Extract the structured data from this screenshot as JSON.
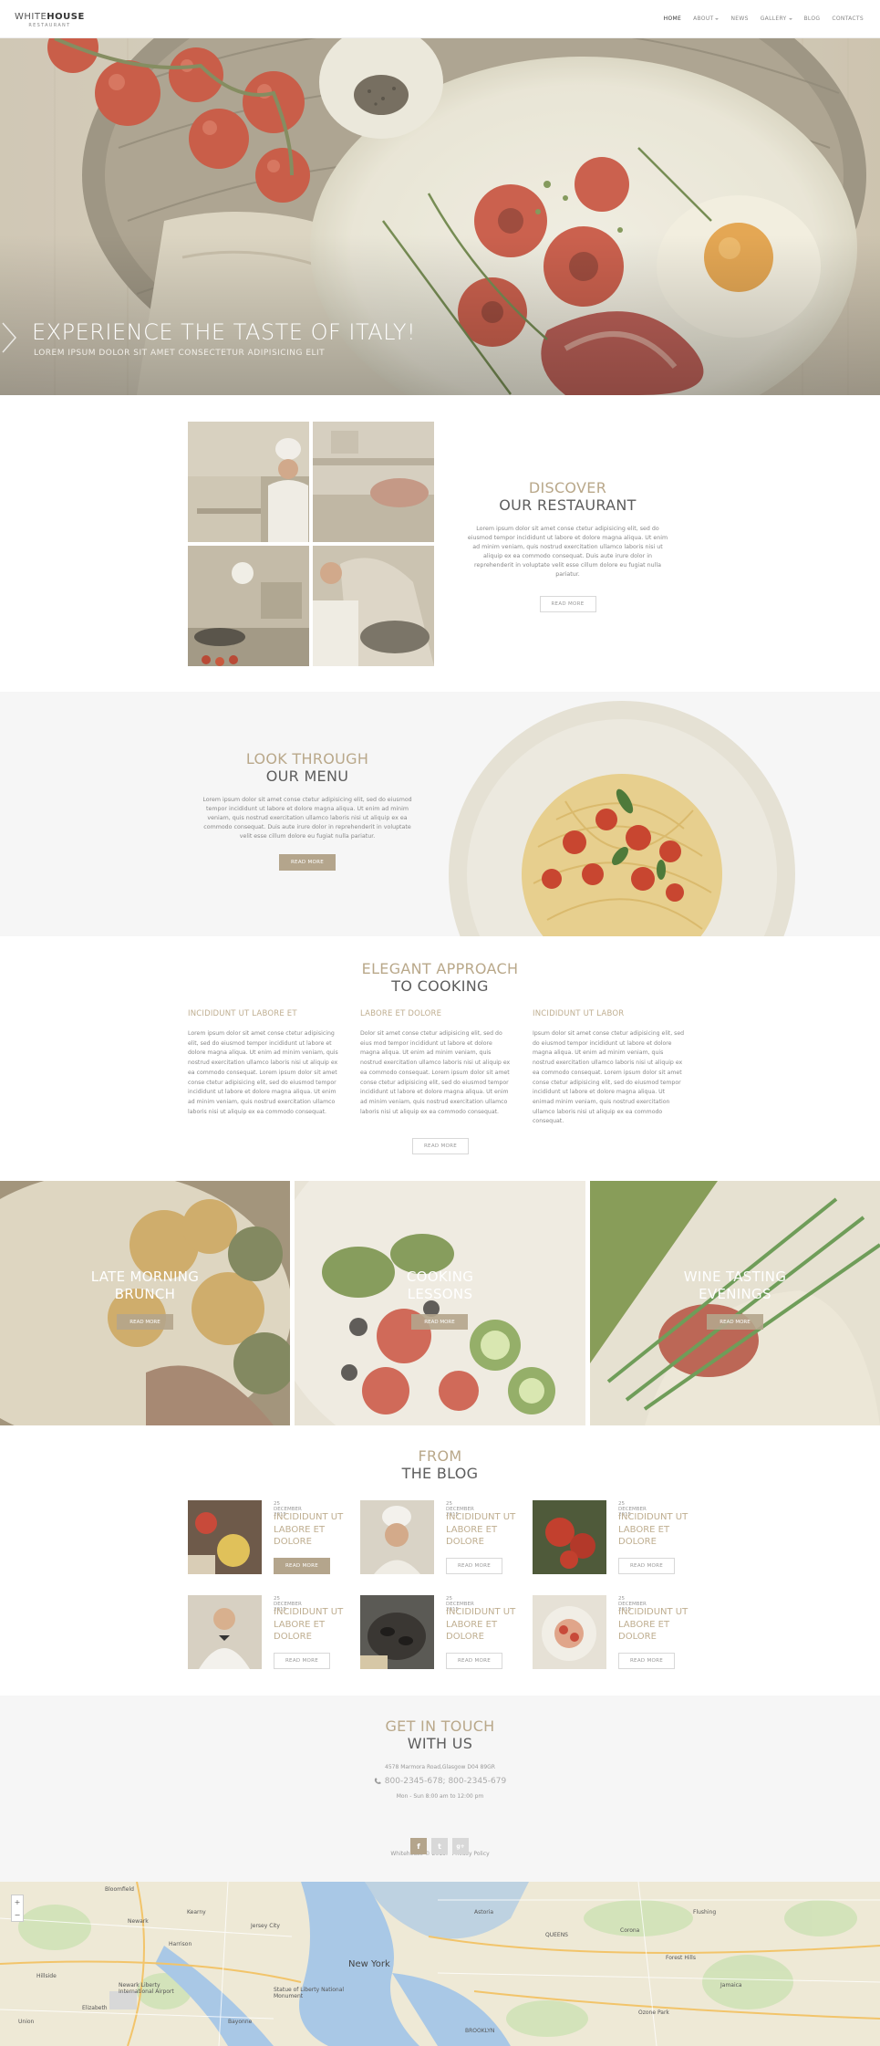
{
  "header": {
    "logo_part1": "WHITE",
    "logo_part2": "HOUSE",
    "logo_sub": "RESTAURANT",
    "nav": [
      {
        "label": "HOME",
        "active": true,
        "dropdown": false
      },
      {
        "label": "ABOUT",
        "active": false,
        "dropdown": true
      },
      {
        "label": "NEWS",
        "active": false,
        "dropdown": false
      },
      {
        "label": "GALLERY",
        "active": false,
        "dropdown": true
      },
      {
        "label": "BLOG",
        "active": false,
        "dropdown": false
      },
      {
        "label": "CONTACTS",
        "active": false,
        "dropdown": false
      }
    ]
  },
  "hero": {
    "title": "EXPERIENCE THE TASTE OF ITALY!",
    "subtitle": "LOREM IPSUM DOLOR SIT AMET CONSECTETUR ADIPISICING ELIT",
    "next_icon": "chevron-right-icon"
  },
  "discover": {
    "title_line1": "DISCOVER",
    "title_line2": "OUR RESTAURANT",
    "text": "Lorem ipsum dolor sit amet conse ctetur adipisicing elit, sed do eiusmod tempor incididunt ut labore et dolore magna aliqua. Ut enim ad minim veniam, quis nostrud exercitation ullamco laboris nisi ut aliquip ex ea commodo consequat. Duis aute irure dolor in reprehenderit in voluptate velit esse cillum dolore eu fugiat nulla pariatur.",
    "button": "READ MORE"
  },
  "menu": {
    "title_line1": "LOOK THROUGH",
    "title_line2": "OUR MENU",
    "text": "Lorem ipsum dolor sit amet conse ctetur adipisicing elit, sed do eiusmod tempor incididunt ut labore et dolore magna aliqua. Ut enim ad minim veniam, quis nostrud exercitation ullamco laboris nisi ut aliquip ex ea commodo consequat. Duis aute irure dolor in reprehenderit in voluptate velit esse cillum dolore eu fugiat nulla pariatur.",
    "button": "READ MORE"
  },
  "cooking": {
    "title_line1": "ELEGANT APPROACH",
    "title_line2": "TO COOKING",
    "columns": [
      {
        "title": "INCIDIDUNT UT LABORE ET",
        "text": "Lorem ipsum dolor sit amet conse ctetur adipisicing elit, sed do eiusmod tempor incididunt ut labore et dolore magna aliqua. Ut enim ad minim veniam, quis nostrud exercitation ullamco laboris nisi ut aliquip ex ea commodo consequat. Lorem ipsum dolor sit amet conse ctetur adipisicing elit, sed do eiusmod tempor incididunt ut labore et dolore magna aliqua. Ut enim ad minim veniam, quis nostrud exercitation ullamco laboris nisi ut aliquip ex ea commodo consequat."
      },
      {
        "title": "LABORE ET DOLORE",
        "text": "Dolor sit amet conse ctetur adipisicing elit, sed do eius mod tempor incididunt ut labore et dolore magna aliqua. Ut enim ad minim veniam, quis nostrud exercitation ullamco laboris nisi ut aliquip ex ea commodo consequat. Lorem ipsum dolor sit amet conse ctetur adipisicing elit, sed do eiusmod tempor incididunt ut labore et dolore magna aliqua. Ut enim ad minim veniam, quis nostrud exercitation ullamco laboris nisi ut aliquip ex ea commodo consequat."
      },
      {
        "title": "INCIDIDUNT UT LABOR",
        "text": "Ipsum dolor sit amet conse ctetur adipisicing elit, sed do eiusmod tempor incididunt ut labore et dolore magna aliqua. Ut enim ad minim veniam, quis nostrud exercitation ullamco laboris nisi ut aliquip ex ea commodo consequat. Lorem ipsum dolor sit amet conse ctetur adipisicing elit, sed do eiusmod tempor incididunt ut labore et dolore magna aliqua. Ut enimad minim veniam, quis nostrud exercitation ullamco laboris nisi ut aliquip ex ea commodo consequat."
      }
    ],
    "button": "READ MORE"
  },
  "events": [
    {
      "line1": "LATE MORNING",
      "line2": "BRUNCH",
      "button": "READ MORE"
    },
    {
      "line1": "COOKING",
      "line2": "LESSONS",
      "button": "READ MORE"
    },
    {
      "line1": "WINE TASTING",
      "line2": "EVENINGS",
      "button": "READ MORE"
    }
  ],
  "blog": {
    "title_line1": "FROM",
    "title_line2": "THE BLOG",
    "posts": [
      {
        "date": "25 DECEMBER 2015",
        "title": "INCIDIDUNT UT LABORE ET DOLORE",
        "button": "READ MORE"
      },
      {
        "date": "25 DECEMBER 2015",
        "title": "INCIDIDUNT UT LABORE ET DOLORE",
        "button": "READ MORE"
      },
      {
        "date": "25 DECEMBER 2015",
        "title": "INCIDIDUNT UT LABORE ET DOLORE",
        "button": "READ MORE"
      },
      {
        "date": "25 DECEMBER 2015",
        "title": "INCIDIDUNT UT LABORE ET DOLORE",
        "button": "READ MORE"
      },
      {
        "date": "25 DECEMBER 2015",
        "title": "INCIDIDUNT UT LABORE ET DOLORE",
        "button": "READ MORE"
      },
      {
        "date": "25 DECEMBER 2015",
        "title": "INCIDIDUNT UT LABORE ET DOLORE",
        "button": "READ MORE"
      }
    ]
  },
  "contact": {
    "title_line1": "GET IN TOUCH",
    "title_line2": "WITH US",
    "address": "4578 Marmora Road,Glasgow D04 89GR",
    "phone": "800-2345-678; 800-2345-679",
    "hours": "Mon - Sun 8:00 am to 12:00 pm",
    "social": [
      "f",
      "t",
      "g+"
    ],
    "copyright": "Whitehouse © 2015.",
    "privacy": "Privacy Policy"
  },
  "map": {
    "labels": [
      "Newark",
      "Jersey City",
      "New York",
      "QUEENS",
      "BROOKLYN",
      "Elizabeth",
      "Bayonne",
      "Jamaica",
      "Flushing",
      "Astoria",
      "Bloomfield",
      "Harrison",
      "Kearny",
      "Corona",
      "Newark Liberty International Airport",
      "Statue of Liberty National Monument",
      "Hillside",
      "Union",
      "Ozone Park",
      "Forest Hills"
    ]
  },
  "colors": {
    "accent": "#b4a58c",
    "accent_text": "#bfae90",
    "dark_text": "#5d5d5d",
    "light_bg": "#f6f6f6"
  }
}
